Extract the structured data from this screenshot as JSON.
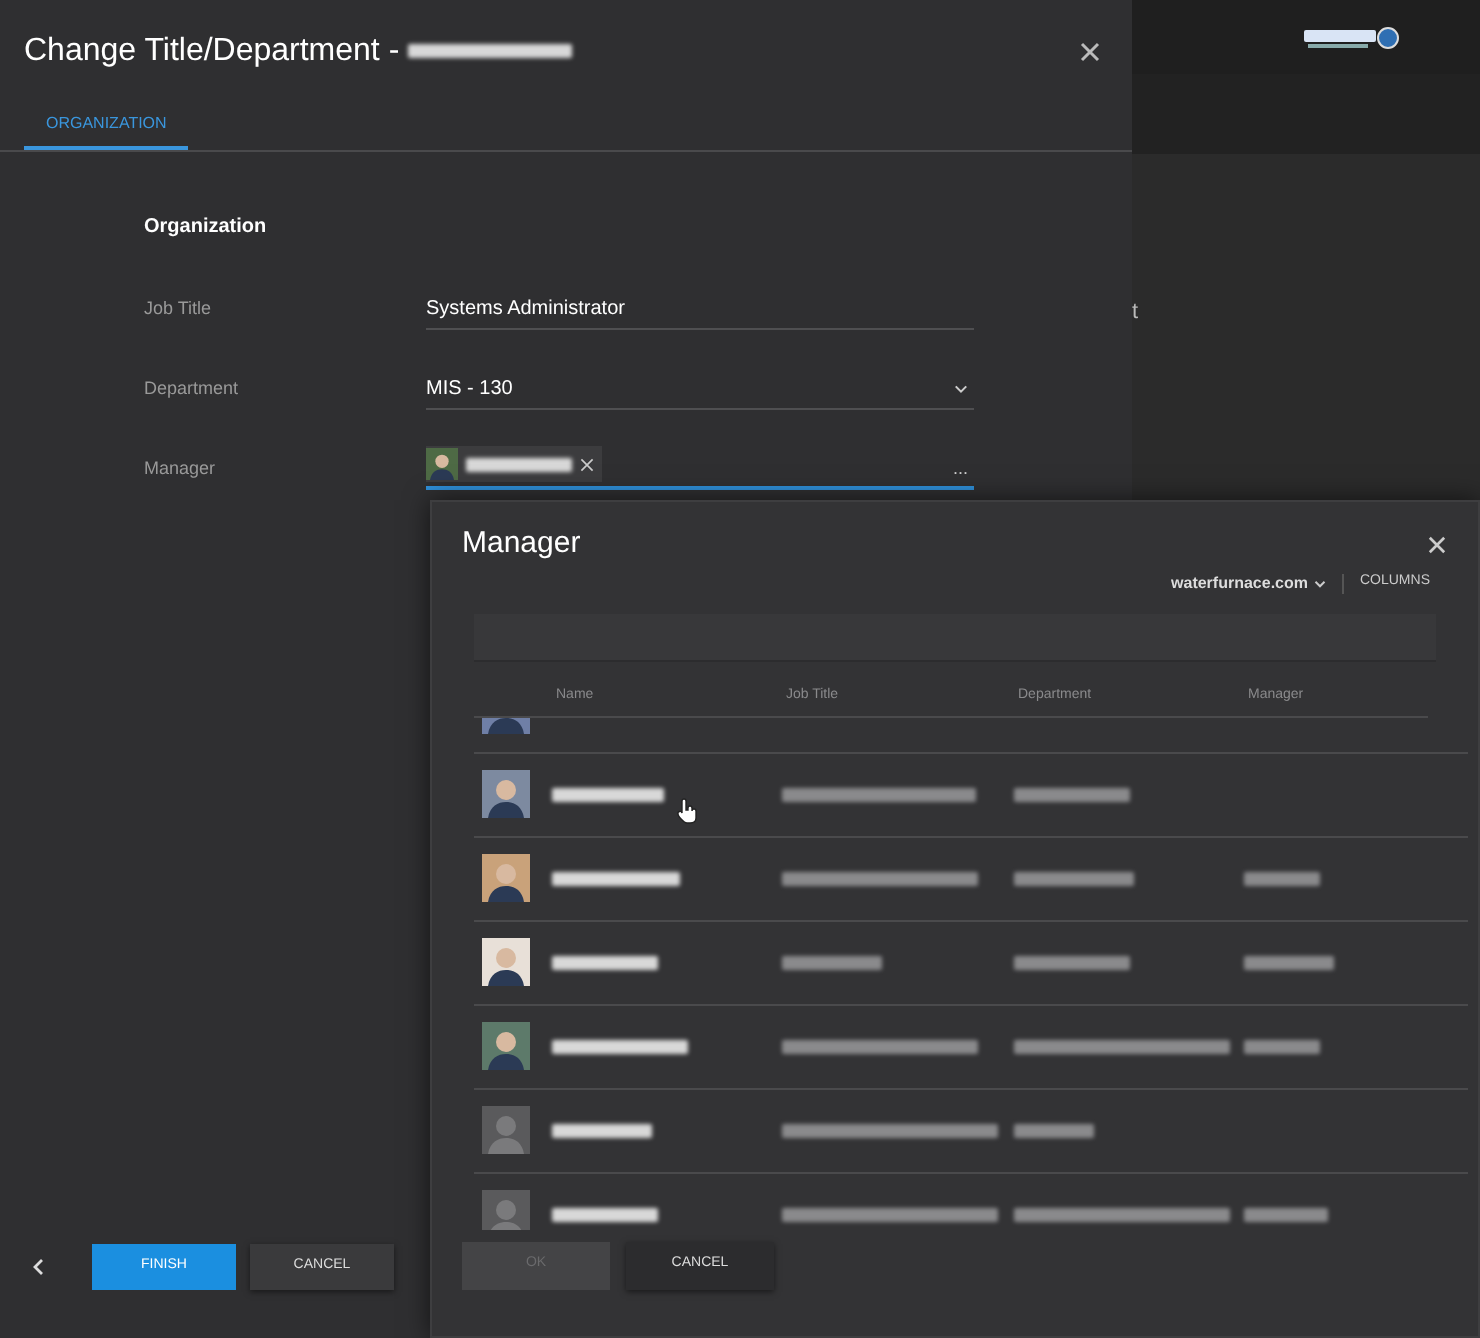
{
  "main_dialog": {
    "title": "Change Title/Department - ",
    "tabs": [
      {
        "label": "ORGANIZATION",
        "selected": true
      }
    ],
    "section": "Organization",
    "fields": [
      {
        "kind": "text",
        "label": "Job Title",
        "value": "Systems Administrator"
      },
      {
        "kind": "dropdown",
        "label": "Department",
        "value": "MIS - 130"
      },
      {
        "kind": "people",
        "label": "Manager",
        "focused": true,
        "more": "..."
      }
    ],
    "buttons": [
      {
        "label": "FINISH",
        "primary": true
      },
      {
        "label": "CANCEL",
        "primary": false
      }
    ]
  },
  "background_text": "t",
  "manager_dialog": {
    "title": "Manager",
    "domain": "waterfurnace.com",
    "columns_button": "COLUMNS",
    "columns": [
      "Name",
      "Job Title",
      "Department",
      "Manager"
    ],
    "rows": [
      {
        "kind": "photo",
        "color": "#6f7fa6",
        "partial": true
      },
      {
        "kind": "photo",
        "color": "#7d8aa0",
        "partial": false,
        "hovered": true,
        "manager_shown": false
      },
      {
        "kind": "photo",
        "color": "#c9a27a",
        "partial": false,
        "hovered": false,
        "manager_shown": true
      },
      {
        "kind": "photo",
        "color": "#e8e0d8",
        "partial": false,
        "hovered": false,
        "manager_shown": true
      },
      {
        "kind": "photo",
        "color": "#5d7a6a",
        "partial": false,
        "hovered": false,
        "manager_shown": true
      },
      {
        "kind": "placeholder",
        "color": "#5a5a5c",
        "partial": false,
        "hovered": false,
        "manager_shown": false
      },
      {
        "kind": "placeholder",
        "color": "#5a5a5c",
        "partial": false,
        "hovered": false,
        "manager_shown": true
      }
    ],
    "buttons": [
      {
        "label": "OK",
        "disabled": true
      },
      {
        "label": "CANCEL",
        "disabled": false
      }
    ]
  }
}
